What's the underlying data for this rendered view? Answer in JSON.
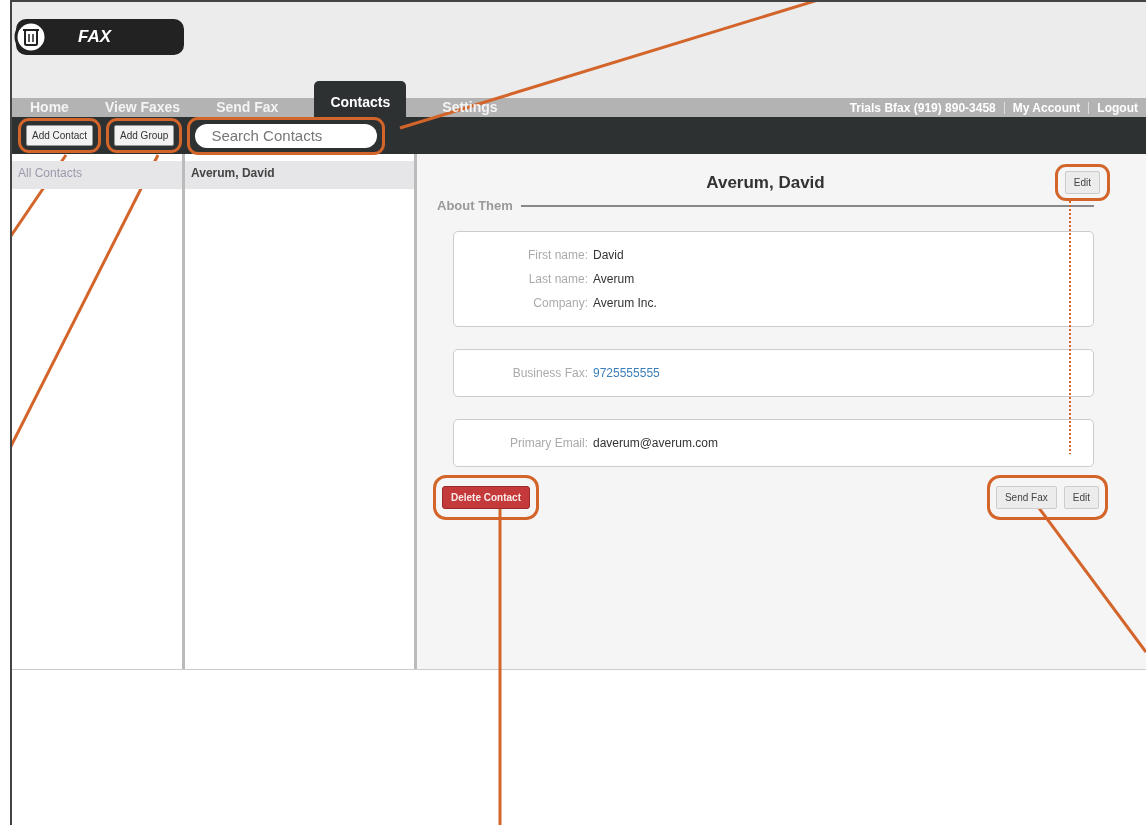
{
  "logo": {
    "text": "FAX"
  },
  "nav": {
    "tabs": [
      {
        "label": "Home",
        "selected": false
      },
      {
        "label": "View Faxes",
        "selected": false
      },
      {
        "label": "Send Fax",
        "selected": false
      },
      {
        "label": "Contacts",
        "selected": true
      },
      {
        "label": "Settings",
        "selected": false
      }
    ],
    "account": "Trials Bfax  (919) 890-3458",
    "links": [
      "My Account",
      "Logout"
    ]
  },
  "toolbar": {
    "buttons": [
      "Add Contact",
      "Add Group"
    ],
    "search": {
      "placeholder": "Search Contacts"
    }
  },
  "groups": [
    {
      "label": "All Contacts",
      "selected": true
    }
  ],
  "contacts": [
    {
      "label": "Averum, David",
      "selected": true
    }
  ],
  "detail": {
    "title": "Averum, David",
    "edit": "Edit",
    "section": "About Them",
    "cards": [
      {
        "fields": [
          {
            "label": "First name:",
            "value": "David",
            "kind": "text"
          },
          {
            "label": "Last name:",
            "value": "Averum",
            "kind": "text"
          },
          {
            "label": "Company:",
            "value": "Averum Inc.",
            "kind": "text"
          }
        ]
      },
      {
        "fields": [
          {
            "label": "Business Fax:",
            "value": "9725555555",
            "kind": "link"
          }
        ]
      },
      {
        "fields": [
          {
            "label": "Primary Email:",
            "value": "daverum@averum.com",
            "kind": "text"
          }
        ]
      }
    ],
    "delete": "Delete Contact",
    "actions": [
      "Send Fax",
      "Edit"
    ]
  }
}
